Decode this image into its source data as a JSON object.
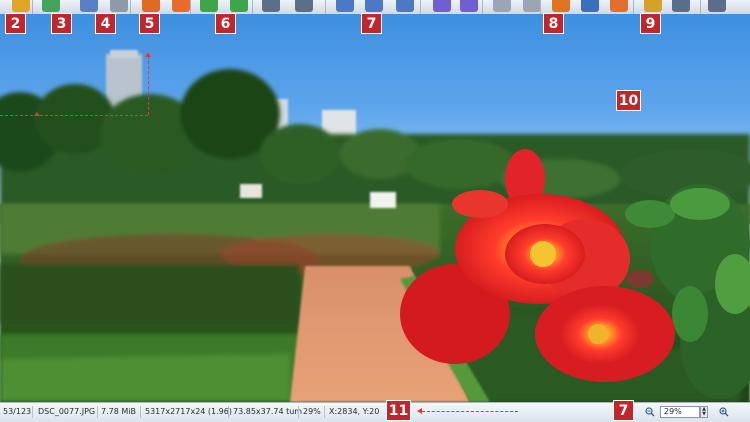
{
  "toolbar": {
    "buttons": [
      {
        "name": "open-file-icon",
        "color": "#e0a527"
      },
      {
        "name": "slideshow-icon",
        "color": "#46a35a"
      },
      {
        "name": "undo-icon",
        "color": "#5a7fc2"
      },
      {
        "name": "redo-icon",
        "color": "#8f9aa8"
      },
      {
        "name": "crop-icon",
        "color": "#e06a22"
      },
      {
        "name": "effects-icon",
        "color": "#e86b2c"
      },
      {
        "name": "rotate-left-icon",
        "color": "#3da648"
      },
      {
        "name": "rotate-right-icon",
        "color": "#3da648"
      },
      {
        "name": "fit-window-icon",
        "color": "#5b6f8a"
      },
      {
        "name": "full-screen-icon",
        "color": "#5b6f8a"
      },
      {
        "name": "zoom-in-icon",
        "color": "#4b79c4"
      },
      {
        "name": "zoom-actual-icon",
        "color": "#4b79c4"
      },
      {
        "name": "zoom-out-icon",
        "color": "#4b79c4"
      },
      {
        "name": "previous-icon",
        "color": "#6f5fd0"
      },
      {
        "name": "next-icon",
        "color": "#6f5fd0"
      },
      {
        "name": "first-file-icon",
        "color": "#9aa6b6"
      },
      {
        "name": "last-file-icon",
        "color": "#9aa6b6"
      },
      {
        "name": "image-properties-icon",
        "color": "#e07420"
      },
      {
        "name": "info-icon",
        "color": "#3a6fc0"
      },
      {
        "name": "print-preview-icon",
        "color": "#e0712a"
      },
      {
        "name": "paint-icon",
        "color": "#d4a22a"
      },
      {
        "name": "print-icon",
        "color": "#5a6d8c"
      },
      {
        "name": "scanner-icon",
        "color": "#5a6d8c"
      }
    ]
  },
  "callouts": [
    "2",
    "3",
    "4",
    "5",
    "6",
    "7",
    "8",
    "9",
    "10",
    "11",
    "7"
  ],
  "status": {
    "index": "53/123",
    "filename": "DSC_0077.JPG",
    "filesize": "7.78 MiB",
    "dimensions": "5317x2717x24 (1.96)",
    "print_size": "73.85x37.74 tum",
    "zoom_percent": "29%",
    "cursor": "X:2834, Y:20",
    "zoom_value": "29%"
  }
}
